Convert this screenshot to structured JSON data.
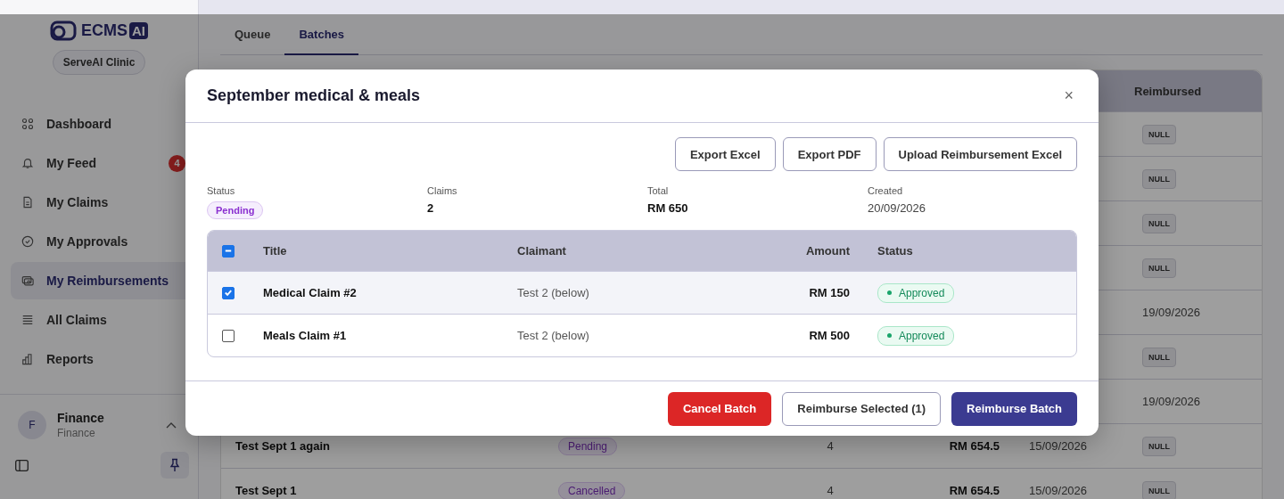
{
  "sidebar": {
    "logo": {
      "text": "ECMS",
      "badge": "AI"
    },
    "org": "ServeAI Clinic",
    "nav": [
      {
        "label": "Dashboard",
        "selected": false
      },
      {
        "label": "My Feed",
        "selected": false,
        "badge": "4"
      },
      {
        "label": "My Claims",
        "selected": false
      },
      {
        "label": "My Approvals",
        "selected": false
      },
      {
        "label": "My Reimbursements",
        "selected": true
      },
      {
        "label": "All Claims",
        "selected": false
      },
      {
        "label": "Reports",
        "selected": false
      }
    ],
    "user": {
      "initial": "F",
      "name": "Finance",
      "role": "Finance"
    }
  },
  "tabs": [
    {
      "label": "Queue",
      "selected": false
    },
    {
      "label": "Batches",
      "selected": true
    }
  ],
  "batches_table": {
    "columns": [
      "Reimbursed"
    ],
    "rows": [
      {
        "reimbursed": {
          "kind": "null",
          "text": "NULL"
        }
      },
      {
        "reimbursed": {
          "kind": "null",
          "text": "NULL"
        }
      },
      {
        "reimbursed": {
          "kind": "null",
          "text": "NULL"
        }
      },
      {
        "reimbursed": {
          "kind": "null",
          "text": "NULL"
        }
      },
      {
        "reimbursed": {
          "kind": "date",
          "text": "19/09/2026"
        }
      },
      {
        "reimbursed": {
          "kind": "null",
          "text": "NULL"
        }
      },
      {
        "reimbursed": {
          "kind": "date",
          "text": "19/09/2026"
        }
      },
      {
        "title": "Test Sept 1 again",
        "status": "Pending",
        "claims": "4",
        "total": "RM 654.5",
        "created": "15/09/2026",
        "reimbursed": {
          "kind": "null",
          "text": "NULL"
        }
      },
      {
        "title": "Test Sept 1",
        "status": "Cancelled",
        "claims": "4",
        "total": "RM 654.5",
        "created": "15/09/2026",
        "reimbursed": {
          "kind": "null",
          "text": "NULL"
        }
      }
    ]
  },
  "modal": {
    "title": "September medical & meals",
    "close": "×",
    "actions": [
      "Export Excel",
      "Export PDF",
      "Upload Reimbursement Excel"
    ],
    "summary": [
      {
        "label": "Status",
        "value": "Pending",
        "kind": "badge"
      },
      {
        "label": "Claims",
        "value": "2",
        "kind": "bold"
      },
      {
        "label": "Total",
        "value": "RM 650",
        "kind": "bold"
      },
      {
        "label": "Created",
        "value": "20/09/2026",
        "kind": "plain"
      }
    ],
    "claims": {
      "select_all": {
        "indeterminate": true
      },
      "columns": [
        "Title",
        "Claimant",
        "Amount",
        "Status"
      ],
      "rows": [
        {
          "title": "Medical Claim #2",
          "claimant": "Test 2 (below)",
          "amount": "RM 150",
          "status": "Approved",
          "checked": true
        },
        {
          "title": "Meals Claim #1",
          "claimant": "Test 2 (below)",
          "amount": "RM 500",
          "status": "Approved",
          "checked": false
        }
      ]
    },
    "footer": [
      {
        "label": "Cancel Batch",
        "kind": "danger"
      },
      {
        "label": "Reimburse Selected (1)",
        "kind": "outline"
      },
      {
        "label": "Reimburse Batch",
        "kind": "primary"
      }
    ]
  }
}
